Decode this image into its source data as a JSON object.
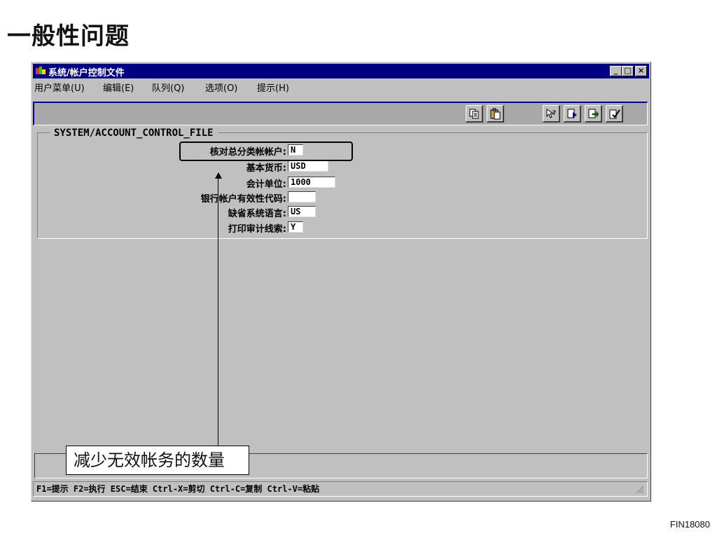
{
  "slide": {
    "title": "一般性问题",
    "code": "FIN18080"
  },
  "window": {
    "title": "系统/帐户控制文件",
    "controls": {
      "minimize": "_",
      "maximize": "□",
      "close": "×"
    }
  },
  "menu": [
    {
      "label": "用户菜单(U)"
    },
    {
      "label": "编辑(E)"
    },
    {
      "label": "队列(Q)"
    },
    {
      "label": "选项(O)"
    },
    {
      "label": "提示(H)"
    }
  ],
  "toolbar_icons": [
    "copy-icon",
    "paste-icon",
    "help-pointer-icon",
    "prompt-icon",
    "insert-icon",
    "execute-icon"
  ],
  "group": {
    "legend": "SYSTEM/ACCOUNT_CONTROL_FILE",
    "fields": [
      {
        "label": "核对总分类帐帐户:",
        "value": "N"
      },
      {
        "label": "基本货币:",
        "value": "USD"
      },
      {
        "label": "会计单位:",
        "value": "1000"
      },
      {
        "label": "银行帐户有效性代码:",
        "value": ""
      },
      {
        "label": "缺省系统语言:",
        "value": "US"
      },
      {
        "label": "打印审计线索:",
        "value": "Y"
      }
    ]
  },
  "callout": {
    "text": "减少无效帐务的数量"
  },
  "statusbar": {
    "text": "F1=提示 F2=执行 ESC=结束 Ctrl-X=剪切 Ctrl-C=复制 Ctrl-V=粘贴"
  },
  "colors": {
    "titlebar": "#000080",
    "window_bg": "#c0c0c0",
    "toolbar_bg": "#a8a8a8"
  }
}
